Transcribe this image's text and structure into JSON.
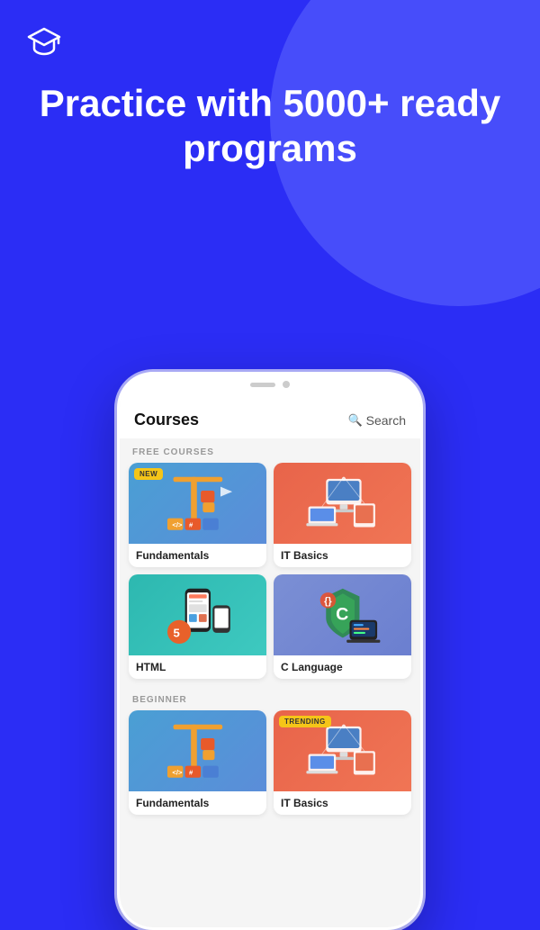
{
  "app": {
    "logo_icon": "🎓",
    "hero_title": "Practice with 5000+ ready programs",
    "bg_color": "#2b2df5"
  },
  "screen": {
    "title": "Courses",
    "search_label": "Search",
    "sections": [
      {
        "id": "free",
        "label": "FREE COURSES",
        "courses": [
          {
            "id": "fundamentals",
            "name": "Fundamentals",
            "theme": "blue",
            "badge": "NEW",
            "badge_type": "new"
          },
          {
            "id": "itbasics",
            "name": "IT Basics",
            "theme": "red",
            "badge": null
          },
          {
            "id": "html",
            "name": "HTML",
            "theme": "teal",
            "badge": null
          },
          {
            "id": "clang",
            "name": "C Language",
            "theme": "purple",
            "badge": null
          }
        ]
      },
      {
        "id": "beginner",
        "label": "BEGINNER",
        "courses": [
          {
            "id": "fundamentals2",
            "name": "Fundamentals",
            "theme": "blue",
            "badge": null
          },
          {
            "id": "itbasics2",
            "name": "IT Basics",
            "theme": "red",
            "badge": "TRENDING",
            "badge_type": "trending"
          }
        ]
      }
    ]
  }
}
